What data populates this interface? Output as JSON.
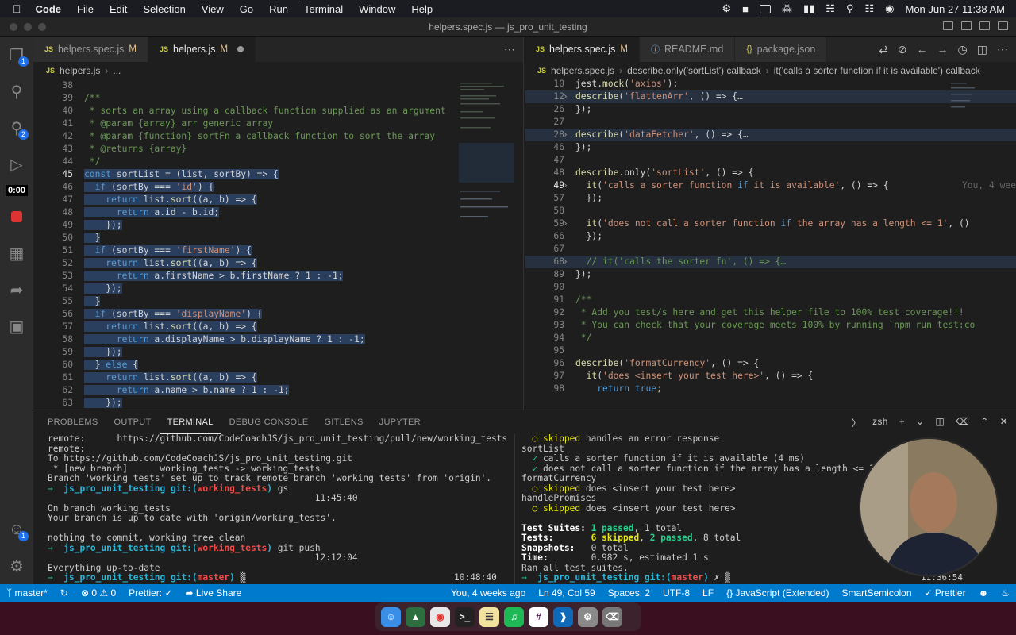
{
  "menubar": {
    "app": "Code",
    "items": [
      "File",
      "Edit",
      "Selection",
      "View",
      "Go",
      "Run",
      "Terminal",
      "Window",
      "Help"
    ],
    "clock": "Mon Jun 27  11:38 AM"
  },
  "window": {
    "title": "helpers.spec.js — js_pro_unit_testing"
  },
  "activity": {
    "explorer_badge": "1",
    "scm_badge": "2",
    "recording_time": "0:00"
  },
  "left": {
    "tabs": [
      {
        "label": "helpers.spec.js",
        "mod": "M"
      },
      {
        "label": "helpers.js",
        "mod": "M"
      }
    ],
    "breadcrumb": [
      "helpers.js",
      "..."
    ],
    "lines": [
      {
        "n": "38",
        "t": ""
      },
      {
        "n": "39",
        "t": "/**"
      },
      {
        "n": "40",
        "t": " * sorts an array using a callback function supplied as an argument"
      },
      {
        "n": "41",
        "t": " * @param {array} arr generic array"
      },
      {
        "n": "42",
        "t": " * @param {function} sortFn a callback function to sort the array"
      },
      {
        "n": "43",
        "t": " * @returns {array}"
      },
      {
        "n": "44",
        "t": " */"
      },
      {
        "n": "45",
        "t": "const sortList = (list, sortBy) => {"
      },
      {
        "n": "46",
        "t": "  if (sortBy === 'id') {"
      },
      {
        "n": "47",
        "t": "    return list.sort((a, b) => {"
      },
      {
        "n": "48",
        "t": "      return a.id - b.id;"
      },
      {
        "n": "49",
        "t": "    });"
      },
      {
        "n": "50",
        "t": "  }"
      },
      {
        "n": "51",
        "t": "  if (sortBy === 'firstName') {"
      },
      {
        "n": "52",
        "t": "    return list.sort((a, b) => {"
      },
      {
        "n": "53",
        "t": "      return a.firstName > b.firstName ? 1 : -1;"
      },
      {
        "n": "54",
        "t": "    });"
      },
      {
        "n": "55",
        "t": "  }"
      },
      {
        "n": "56",
        "t": "  if (sortBy === 'displayName') {"
      },
      {
        "n": "57",
        "t": "    return list.sort((a, b) => {"
      },
      {
        "n": "58",
        "t": "      return a.displayName > b.displayName ? 1 : -1;"
      },
      {
        "n": "59",
        "t": "    });"
      },
      {
        "n": "60",
        "t": "  } else {"
      },
      {
        "n": "61",
        "t": "    return list.sort((a, b) => {"
      },
      {
        "n": "62",
        "t": "      return a.name > b.name ? 1 : -1;"
      },
      {
        "n": "63",
        "t": "    });"
      }
    ]
  },
  "right": {
    "tabs": [
      {
        "label": "helpers.spec.js",
        "mod": "M"
      },
      {
        "label": "README.md",
        "mod": ""
      },
      {
        "label": "package.json",
        "mod": ""
      }
    ],
    "breadcrumb": [
      "helpers.spec.js",
      "describe.only('sortList') callback",
      "it('calls a sorter function if it is available') callback"
    ],
    "lines": [
      {
        "n": "10",
        "t": "jest.mock('axios');"
      },
      {
        "n": "12",
        "t": "describe('flattenArr', () => {…"
      },
      {
        "n": "26",
        "t": "});"
      },
      {
        "n": "27",
        "t": ""
      },
      {
        "n": "28",
        "t": "describe('dataFetcher', () => {…"
      },
      {
        "n": "46",
        "t": "});"
      },
      {
        "n": "47",
        "t": ""
      },
      {
        "n": "48",
        "t": "describe.only('sortList', () => {"
      },
      {
        "n": "49",
        "t": "  it('calls a sorter function if it is available', () => {"
      },
      {
        "n": "57",
        "t": "  });"
      },
      {
        "n": "58",
        "t": ""
      },
      {
        "n": "59",
        "t": "  it('does not call a sorter function if the array has a length <= 1', ()"
      },
      {
        "n": "66",
        "t": "  });"
      },
      {
        "n": "67",
        "t": ""
      },
      {
        "n": "68",
        "t": "  // it('calls the sorter fn', () => {…"
      },
      {
        "n": "89",
        "t": "});"
      },
      {
        "n": "90",
        "t": ""
      },
      {
        "n": "91",
        "t": "/**"
      },
      {
        "n": "92",
        "t": " * Add you test/s here and get this helper file to 100% test coverage!!!"
      },
      {
        "n": "93",
        "t": " * You can check that your coverage meets 100% by running `npm run test:co"
      },
      {
        "n": "94",
        "t": " */"
      },
      {
        "n": "95",
        "t": ""
      },
      {
        "n": "96",
        "t": "describe('formatCurrency', () => {"
      },
      {
        "n": "97",
        "t": "  it('does <insert your test here>', () => {"
      },
      {
        "n": "98",
        "t": "    return true;"
      }
    ],
    "blame": "You, 4 wee"
  },
  "panel": {
    "tabs": [
      "PROBLEMS",
      "OUTPUT",
      "TERMINAL",
      "DEBUG CONSOLE",
      "GITLENS",
      "JUPYTER"
    ],
    "shell": "zsh",
    "left_term": [
      "remote:      https://github.com/CodeCoachJS/js_pro_unit_testing/pull/new/working_tests",
      "remote:",
      "To https://github.com/CodeCoachJS/js_pro_unit_testing.git",
      " * [new branch]      working_tests -> working_tests",
      "Branch 'working_tests' set up to track remote branch 'working_tests' from 'origin'.",
      "→  js_pro_unit_testing git:(working_tests) gs",
      "                                                  11:45:40",
      "On branch working_tests",
      "Your branch is up to date with 'origin/working_tests'.",
      "",
      "nothing to commit, working tree clean",
      "→  js_pro_unit_testing git:(working_tests) git push",
      "                                                  12:12:04",
      "Everything up-to-date",
      "→  js_pro_unit_testing git:(master) ▒                                       10:48:40"
    ],
    "right_term": [
      "  ○ skipped handles an error response",
      "sortList",
      "  ✓ calls a sorter function if it is available (4 ms)",
      "  ✓ does not call a sorter function if the array has a length <= 1 (2",
      "formatCurrency",
      "  ○ skipped does <insert your test here>",
      "handlePromises",
      "  ○ skipped does <insert your test here>",
      "",
      "Test Suites: 1 passed, 1 total",
      "Tests:       6 skipped, 2 passed, 8 total",
      "Snapshots:   0 total",
      "Time:        0.982 s, estimated 1 s",
      "Ran all test suites.",
      "→  js_pro_unit_testing git:(master) ✗ ▒"
    ],
    "right_time": "11:36:54"
  },
  "status": {
    "branch": "master*",
    "problems": "⊗ 0 ⚠ 0",
    "prettier": "Prettier: ✓",
    "liveshare": "Live Share",
    "blame": "You, 4 weeks ago",
    "pos": "Ln 49, Col 59",
    "spaces": "Spaces: 2",
    "enc": "UTF-8",
    "eol": "LF",
    "lang": "JavaScript (Extended)",
    "semi": "SmartSemicolon",
    "prettier2": "✓ Prettier"
  },
  "colors": {
    "accent": "#007acc",
    "activity": "#2c2c2c",
    "editor": "#1e1e1e"
  }
}
